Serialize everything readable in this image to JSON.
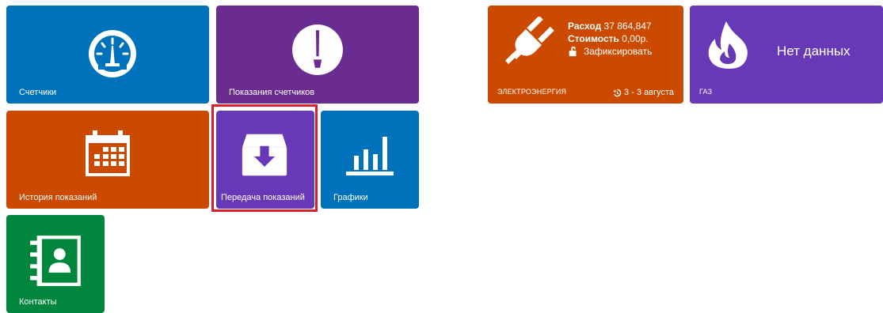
{
  "tiles": {
    "meters": {
      "label": "Счетчики",
      "icon": "gauge-icon",
      "color": "#0072bc"
    },
    "meter_readings": {
      "label": "Показания счетчиков",
      "icon": "dial-icon",
      "color": "#6b2c91"
    },
    "history": {
      "label": "История показаний",
      "icon": "calendar-icon",
      "color": "#cc4a00"
    },
    "submit": {
      "label": "Передача показаний",
      "icon": "inbox-download-icon",
      "color": "#6739b7",
      "selected": true
    },
    "charts": {
      "label": "Графики",
      "icon": "bar-chart-icon",
      "color": "#0072bc"
    },
    "contacts": {
      "label": "Контакты",
      "icon": "address-book-icon",
      "color": "#00873d"
    }
  },
  "electricity": {
    "title": "ЭЛЕКТРОЭНЕРГИЯ",
    "consumption_label": "Расход",
    "consumption_value": "37 864,847",
    "cost_label": "Стоимость",
    "cost_value": "0,00р.",
    "lock_label": "Зафиксировать",
    "date_range": "3 - 3 августа",
    "icon": "plug-icon",
    "color": "#cc4a00"
  },
  "gas": {
    "title": "ГАЗ",
    "status": "Нет данных",
    "icon": "flame-icon",
    "color": "#6739b7"
  }
}
